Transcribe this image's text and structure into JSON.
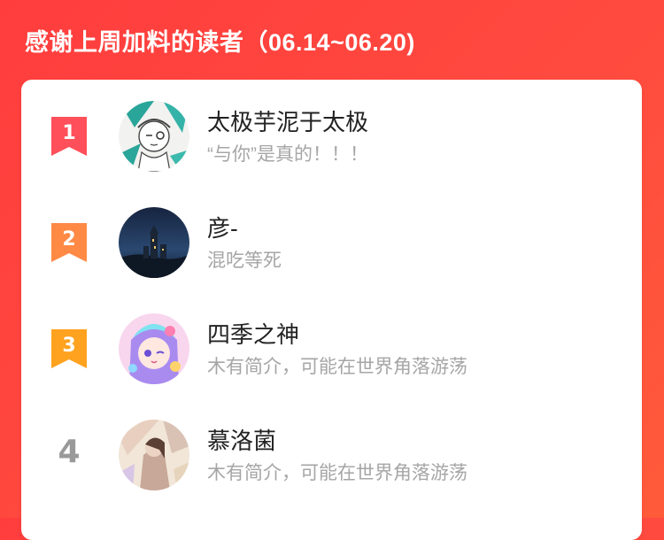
{
  "header": {
    "title": "感谢上周加料的读者（06.14~06.20)"
  },
  "colors": {
    "background": "#ff4040",
    "rank1": "#ff4f5a",
    "rank2": "#ff8a45",
    "rank3": "#ffa21f",
    "rank_plain": "#999999",
    "name_text": "#222222",
    "desc_text": "#a6a6a6"
  },
  "readers": [
    {
      "rank": "1",
      "name": "太极芋泥于太极",
      "desc": "“与你”是真的！！！",
      "avatar": "sketch-character-avatar"
    },
    {
      "rank": "2",
      "name": "彦-",
      "desc": "混吃等死",
      "avatar": "night-castle-avatar"
    },
    {
      "rank": "3",
      "name": "四季之神",
      "desc": "木有简介，可能在世界角落游荡",
      "avatar": "anime-girl-avatar"
    },
    {
      "rank": "4",
      "name": "慕洛菌",
      "desc": "木有简介，可能在世界角落游荡",
      "avatar": "painted-figure-avatar"
    }
  ]
}
